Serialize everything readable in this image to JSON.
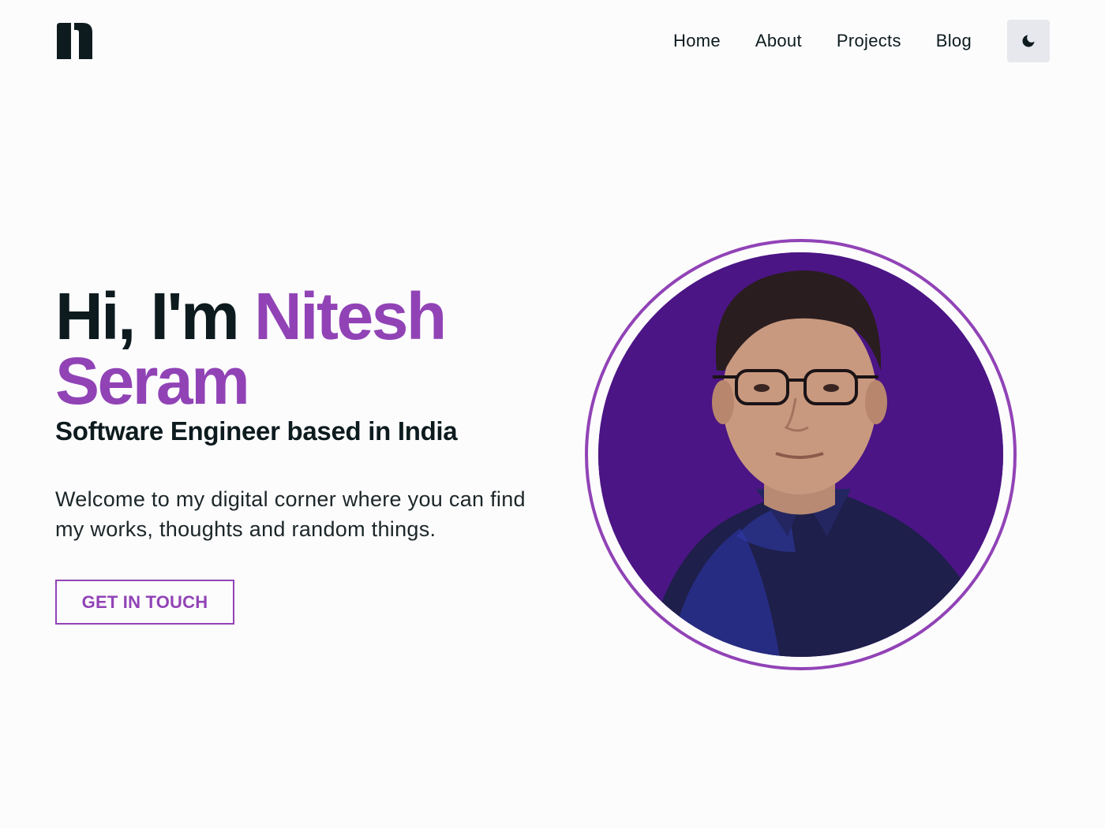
{
  "header": {
    "logo_icon": "n-logo-icon",
    "nav": [
      {
        "label": "Home"
      },
      {
        "label": "About"
      },
      {
        "label": "Projects"
      },
      {
        "label": "Blog"
      }
    ],
    "theme_toggle_icon": "moon-icon"
  },
  "hero": {
    "greeting": "Hi, I'm ",
    "name": "Nitesh Seram",
    "subtitle": "Software Engineer based in India",
    "intro": "Welcome to my digital corner where you can find my works, thoughts and random things.",
    "cta_label": "GET IN TOUCH",
    "avatar_icon": "profile-photo"
  },
  "colors": {
    "accent": "#9143b6",
    "text": "#0d1b1e",
    "background": "#fcfcfd",
    "avatar_background": "#4b1585",
    "toggle_background": "#e6e8ed"
  }
}
